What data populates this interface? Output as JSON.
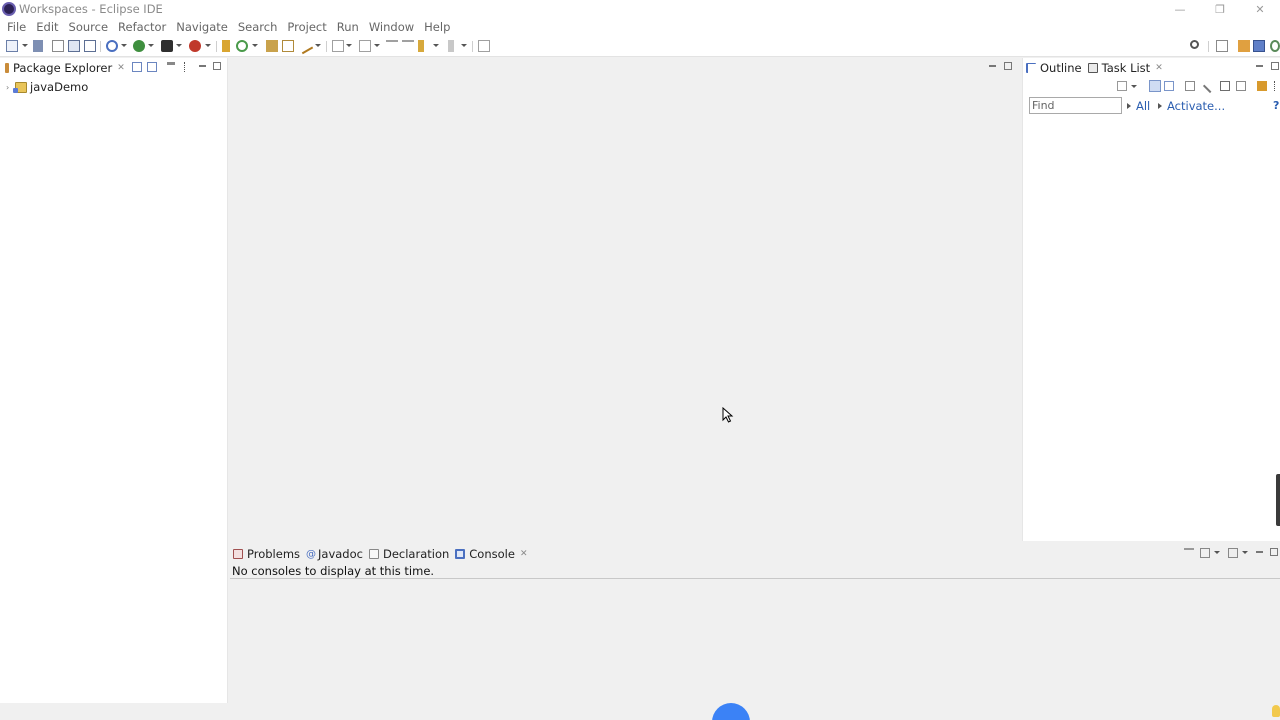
{
  "window": {
    "title": "Workspaces - Eclipse IDE",
    "controls": [
      "minimize-icon",
      "restore-icon",
      "close-icon"
    ]
  },
  "menubar": {
    "items": [
      "File",
      "Edit",
      "Source",
      "Refactor",
      "Navigate",
      "Search",
      "Project",
      "Run",
      "Window",
      "Help"
    ]
  },
  "package_explorer": {
    "tab_label": "Package Explorer",
    "tree": [
      {
        "label": "javaDemo",
        "icon": "java-project-icon",
        "expanded": false
      }
    ]
  },
  "right_panel": {
    "tabs": [
      {
        "label": "Outline",
        "icon": "outline-icon"
      },
      {
        "label": "Task List",
        "icon": "task-list-icon"
      }
    ],
    "find_placeholder": "Find",
    "all_link": "All",
    "activate_link": "Activate..."
  },
  "bottom_panel": {
    "tabs": [
      {
        "label": "Problems",
        "icon": "problems-icon"
      },
      {
        "label": "Javadoc",
        "icon": "javadoc-icon"
      },
      {
        "label": "Declaration",
        "icon": "declaration-icon"
      },
      {
        "label": "Console",
        "icon": "console-icon",
        "active": true
      }
    ],
    "console_message": "No consoles to display at this time."
  },
  "colors": {
    "link": "#2a5db0",
    "panel_bg": "#ffffff",
    "workbench_bg": "#f0f0f0",
    "badge": "#3b82f6"
  }
}
